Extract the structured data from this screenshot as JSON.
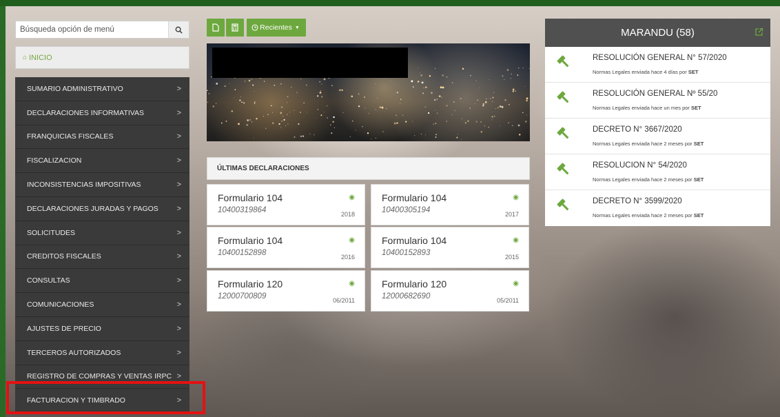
{
  "search": {
    "placeholder": "Búsqueda opción de menú",
    "icon": "search-icon"
  },
  "inicio": {
    "icon": "home-icon",
    "label": "INICIO"
  },
  "menu": [
    "SUMARIO ADMINISTRATIVO",
    "DECLARACIONES INFORMATIVAS",
    "FRANQUICIAS FISCALES",
    "FISCALIZACION",
    "INCONSISTENCIAS IMPOSITIVAS",
    "DECLARACIONES JURADAS Y PAGOS",
    "SOLICITUDES",
    "CREDITOS FISCALES",
    "CONSULTAS",
    "COMUNICACIONES",
    "AJUSTES DE PRECIO",
    "TERCEROS AUTORIZADOS",
    "REGISTRO DE COMPRAS Y VENTAS IRPC",
    "FACTURACION Y TIMBRADO"
  ],
  "menu_chevron": ">",
  "highlighted_item": "FACTURACION Y TIMBRADO",
  "toolbar": {
    "recientes_label": "Recientes",
    "accent": "#6da83e"
  },
  "declarations": {
    "heading": "ÚLTIMAS DECLARACIONES",
    "cards": [
      {
        "title": "Formulario 104",
        "number": "10400319864",
        "period": "2018"
      },
      {
        "title": "Formulario 104",
        "number": "10400305194",
        "period": "2017"
      },
      {
        "title": "Formulario 104",
        "number": "10400152898",
        "period": "2016"
      },
      {
        "title": "Formulario 104",
        "number": "10400152893",
        "period": "2015"
      },
      {
        "title": "Formulario 120",
        "number": "12000700809",
        "period": "06/2011"
      },
      {
        "title": "Formulario 120",
        "number": "12000682690",
        "period": "05/2011"
      }
    ]
  },
  "marandu": {
    "title": "MARANDU (58)",
    "items": [
      {
        "title": "RESOLUCIÓN GENERAL N° 57/2020",
        "sub": "Normas Legales enviada hace 4 días por ",
        "by": "SET"
      },
      {
        "title": "RESOLUCIÓN GENERAL Nº 55/20",
        "sub": "Normas Legales enviada hace un mes por ",
        "by": "SET"
      },
      {
        "title": "DECRETO N° 3667/2020",
        "sub": "Normas Legales enviada hace 2 meses por ",
        "by": "SET"
      },
      {
        "title": "RESOLUCION N° 54/2020",
        "sub": "Normas Legales enviada hace 2 meses por ",
        "by": "SET"
      },
      {
        "title": "DECRETO N° 3599/2020",
        "sub": "Normas Legales enviada hace 2 meses por ",
        "by": "SET"
      }
    ]
  },
  "colors": {
    "brand_green": "#6da83e",
    "highlight_red": "#e31212",
    "sidebar": "#3a3a3a"
  }
}
